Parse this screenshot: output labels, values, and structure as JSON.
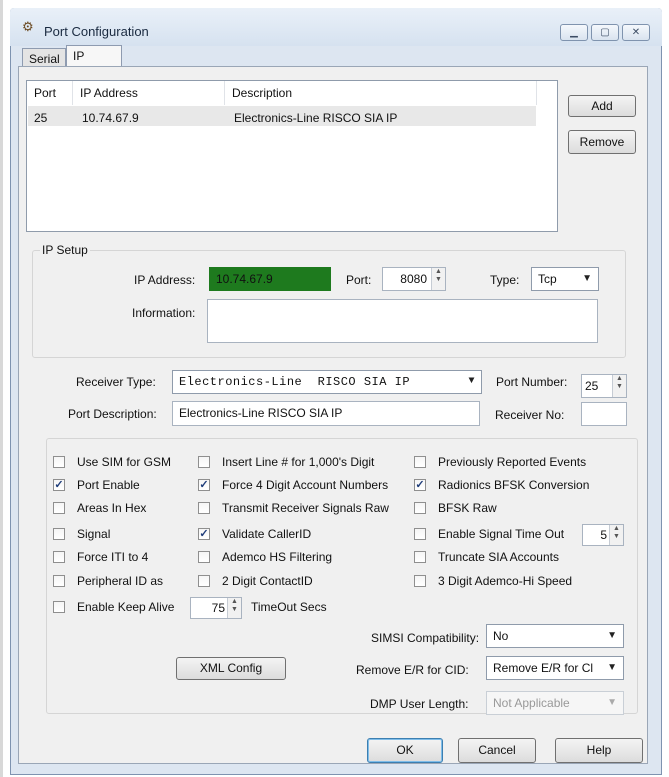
{
  "window": {
    "title": "Port Configuration",
    "icon": "app-icon"
  },
  "tabs": [
    {
      "label": "Serial"
    },
    {
      "label": "IP"
    }
  ],
  "list": {
    "columns": [
      "Port",
      "IP Address",
      "Description"
    ],
    "rows": [
      {
        "port": "25",
        "ip": "10.74.67.9",
        "description": "Electronics-Line RISCO SIA IP"
      }
    ]
  },
  "buttons": {
    "add": "Add",
    "remove": "Remove",
    "xml_config": "XML Config",
    "ok": "OK",
    "cancel": "Cancel",
    "help": "Help"
  },
  "ip_setup": {
    "group_label": "IP Setup",
    "ip_address_label": "IP Address:",
    "ip_address_value": "10.74.67.9",
    "port_label": "Port:",
    "port_value": "8080",
    "type_label": "Type:",
    "type_value": "Tcp",
    "information_label": "Information:",
    "information_value": ""
  },
  "receiver": {
    "type_label": "Receiver Type:",
    "type_value": "Electronics-Line  RISCO SIA IP",
    "port_number_label": "Port Number:",
    "port_number_value": "25",
    "port_description_label": "Port Description:",
    "port_description_value": "Electronics-Line RISCO SIA IP",
    "receiver_no_label": "Receiver No:",
    "receiver_no_value": ""
  },
  "options": {
    "col1": [
      {
        "label": "Use SIM for GSM",
        "checked": false
      },
      {
        "label": "Port Enable",
        "checked": true
      },
      {
        "label": "Areas In Hex",
        "checked": false
      },
      {
        "label": "Signal",
        "checked": false
      },
      {
        "label": "Force ITI to 4",
        "checked": false
      },
      {
        "label": "Peripheral ID as",
        "checked": false
      },
      {
        "label": "Enable Keep Alive",
        "checked": false
      }
    ],
    "col2": [
      {
        "label": "Insert Line # for 1,000's Digit",
        "checked": false
      },
      {
        "label": "Force 4 Digit Account Numbers",
        "checked": true
      },
      {
        "label": "Transmit Receiver Signals Raw",
        "checked": false
      },
      {
        "label": "Validate CallerID",
        "checked": true
      },
      {
        "label": "Ademco HS Filtering",
        "checked": false
      },
      {
        "label": "2 Digit ContactID",
        "checked": false
      }
    ],
    "col3": [
      {
        "label": "Previously Reported Events",
        "checked": false
      },
      {
        "label": "Radionics BFSK Conversion",
        "checked": true
      },
      {
        "label": "BFSK Raw",
        "checked": false
      },
      {
        "label": "Enable Signal Time Out",
        "checked": false
      },
      {
        "label": "Truncate SIA Accounts",
        "checked": false
      },
      {
        "label": "3 Digit Ademco-Hi Speed",
        "checked": false
      }
    ],
    "signal_timeout_value": "5",
    "keepalive_value": "75",
    "timeout_secs_label": "TimeOut Secs"
  },
  "bottom": {
    "simsi_label": "SIMSI Compatibility:",
    "simsi_value": "No",
    "remove_er_label": "Remove E/R for CID:",
    "remove_er_value": "Remove E/R for Cl",
    "dmp_label": "DMP User Length:",
    "dmp_value": "Not Applicable"
  },
  "colors": {
    "ip_highlight": "#1e7a1e",
    "check_mark": "#1f3d7a"
  }
}
